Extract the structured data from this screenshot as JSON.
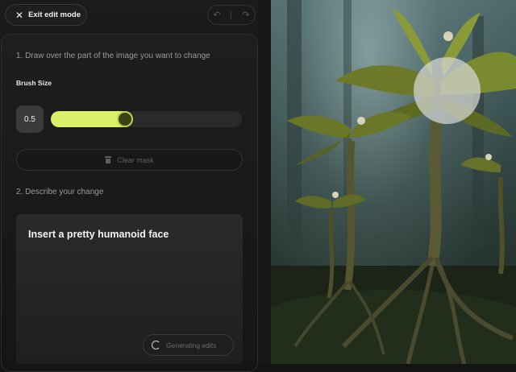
{
  "topbar": {
    "exit_label": "Exit edit mode",
    "exit_icon": "close-icon",
    "undo_icon": "undo-icon",
    "redo_icon": "redo-icon"
  },
  "editor": {
    "step1_title": "1. Draw over the part of the image you want to change",
    "brush_label": "Brush Size",
    "brush_value": "0.5",
    "brush_fraction": 0.43,
    "clear_mask_label": "Clear mask",
    "step2_title": "2. Describe your change",
    "prompt_text": "Insert a pretty humanoid face",
    "generating_label": "Generating edits"
  },
  "colors": {
    "accent": "#d9f06a",
    "panel_bg": "#1b1b1b"
  }
}
